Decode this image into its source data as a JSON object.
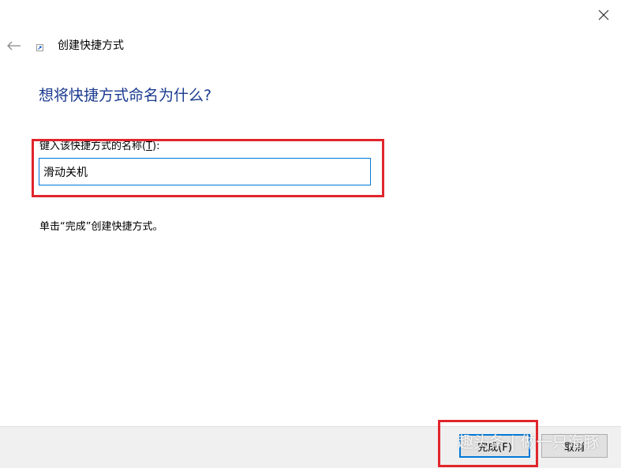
{
  "window": {
    "title": "创建快捷方式"
  },
  "page": {
    "heading": "想将快捷方式命名为什么?",
    "field_label_prefix": "键入该快捷方式的名称(",
    "field_label_mnemonic": "T",
    "field_label_suffix": "):",
    "shortcut_name_value": "滑动关机",
    "hint": "单击“完成”创建快捷方式。"
  },
  "footer": {
    "finish_label": "完成(F)",
    "cancel_label": "取消"
  },
  "watermark": {
    "text": "趣头条 | 做一只海豚"
  },
  "colors": {
    "heading": "#1a3a8f",
    "focus_border": "#0078d7",
    "highlight": "#e0262b",
    "footer_bg": "#f0f0f0"
  },
  "icons": {
    "back": "back-arrow-icon",
    "close": "close-icon",
    "shortcut": "shortcut-icon"
  }
}
